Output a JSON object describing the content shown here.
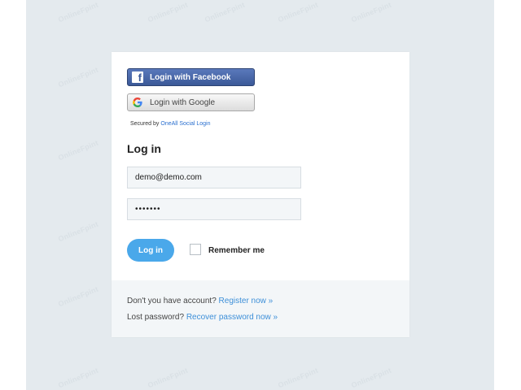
{
  "social": {
    "facebook_label": "Login with Facebook",
    "google_label": "Login with Google",
    "secured_prefix": "Secured by",
    "secured_link": "OneAll Social Login"
  },
  "form": {
    "title": "Log in",
    "email_value": "demo@demo.com",
    "password_value": "•••••••",
    "login_label": "Log in",
    "remember_label": "Remember me",
    "remember_checked": false
  },
  "footer": {
    "register_text": "Don't you have account?",
    "register_link": "Register now »",
    "lost_text": "Lost password?",
    "recover_link": "Recover password now »"
  },
  "watermark": "OnlineFpint",
  "icons": {
    "facebook": "facebook-icon",
    "google": "google-icon"
  },
  "colors": {
    "background": "#e4eaee",
    "accent": "#4aa8ea",
    "facebook": "#3b5998",
    "link": "#3d8fd8"
  }
}
